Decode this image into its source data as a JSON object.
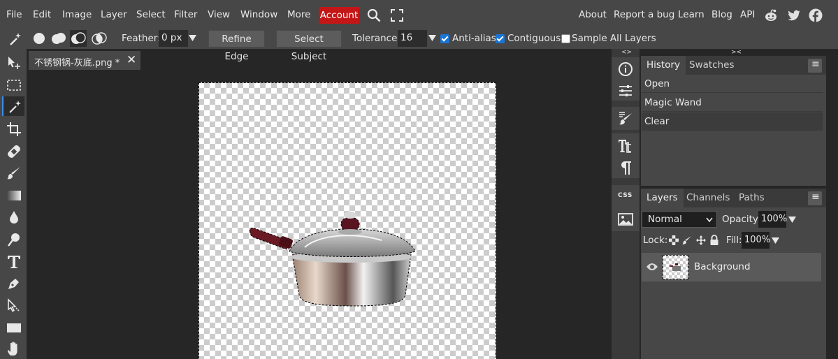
{
  "menu": {
    "items": [
      "File",
      "Edit",
      "Image",
      "Layer",
      "Select",
      "Filter",
      "View",
      "Window",
      "More"
    ],
    "account_label": "Account",
    "right_links": [
      "About",
      "Report a bug",
      "Learn",
      "Blog",
      "API"
    ]
  },
  "options": {
    "feather_label": "Feather:",
    "feather_value": "0 px",
    "refine_edge_label": "Refine Edge",
    "select_subject_label": "Select Subject",
    "tolerance_label": "Tolerance:",
    "tolerance_value": "16",
    "antialias_label": "Anti-alias",
    "antialias_checked": true,
    "contiguous_label": "Contiguous",
    "contiguous_checked": true,
    "sample_all_label": "Sample All Layers",
    "sample_all_checked": false
  },
  "document": {
    "tab_title": "不锈钢锅-灰底.png *",
    "close_glyph": "✕"
  },
  "history_panel": {
    "tabs": [
      "History",
      "Swatches"
    ],
    "items": [
      "Open",
      "Magic Wand",
      "Clear"
    ]
  },
  "layers_panel": {
    "tabs": [
      "Layers",
      "Channels",
      "Paths"
    ],
    "blend_mode": "Normal",
    "opacity_label": "Opacity:",
    "opacity_value": "100%",
    "lock_label": "Lock:",
    "fill_label": "Fill:",
    "fill_value": "100%",
    "layers": [
      {
        "name": "Background",
        "visible": true
      }
    ]
  },
  "strip": {
    "css_label": "CSS"
  },
  "colors": {
    "accent": "#c41616",
    "active_tool": "#3d8ee8",
    "checkbox": "#1a75d6"
  }
}
